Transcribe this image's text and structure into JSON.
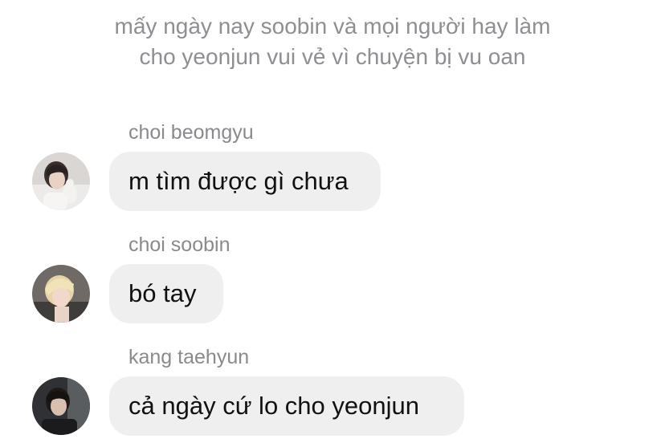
{
  "system_message": {
    "line1": "mấy ngày nay soobin và mọi người hay làm",
    "line2": "cho yeonjun vui vẻ vì chuyện bị vu oan"
  },
  "messages": [
    {
      "sender": "choi beomgyu",
      "text": "m tìm được gì chưa"
    },
    {
      "sender": "choi soobin",
      "text": "bó tay"
    },
    {
      "sender": "kang taehyun",
      "text": "cả ngày cứ lo cho yeonjun"
    }
  ],
  "colors": {
    "bubble": "#efefef",
    "meta_text": "#8e8e93",
    "message_text": "#111111",
    "background": "#ffffff"
  },
  "icons": [
    "avatar-photo"
  ]
}
